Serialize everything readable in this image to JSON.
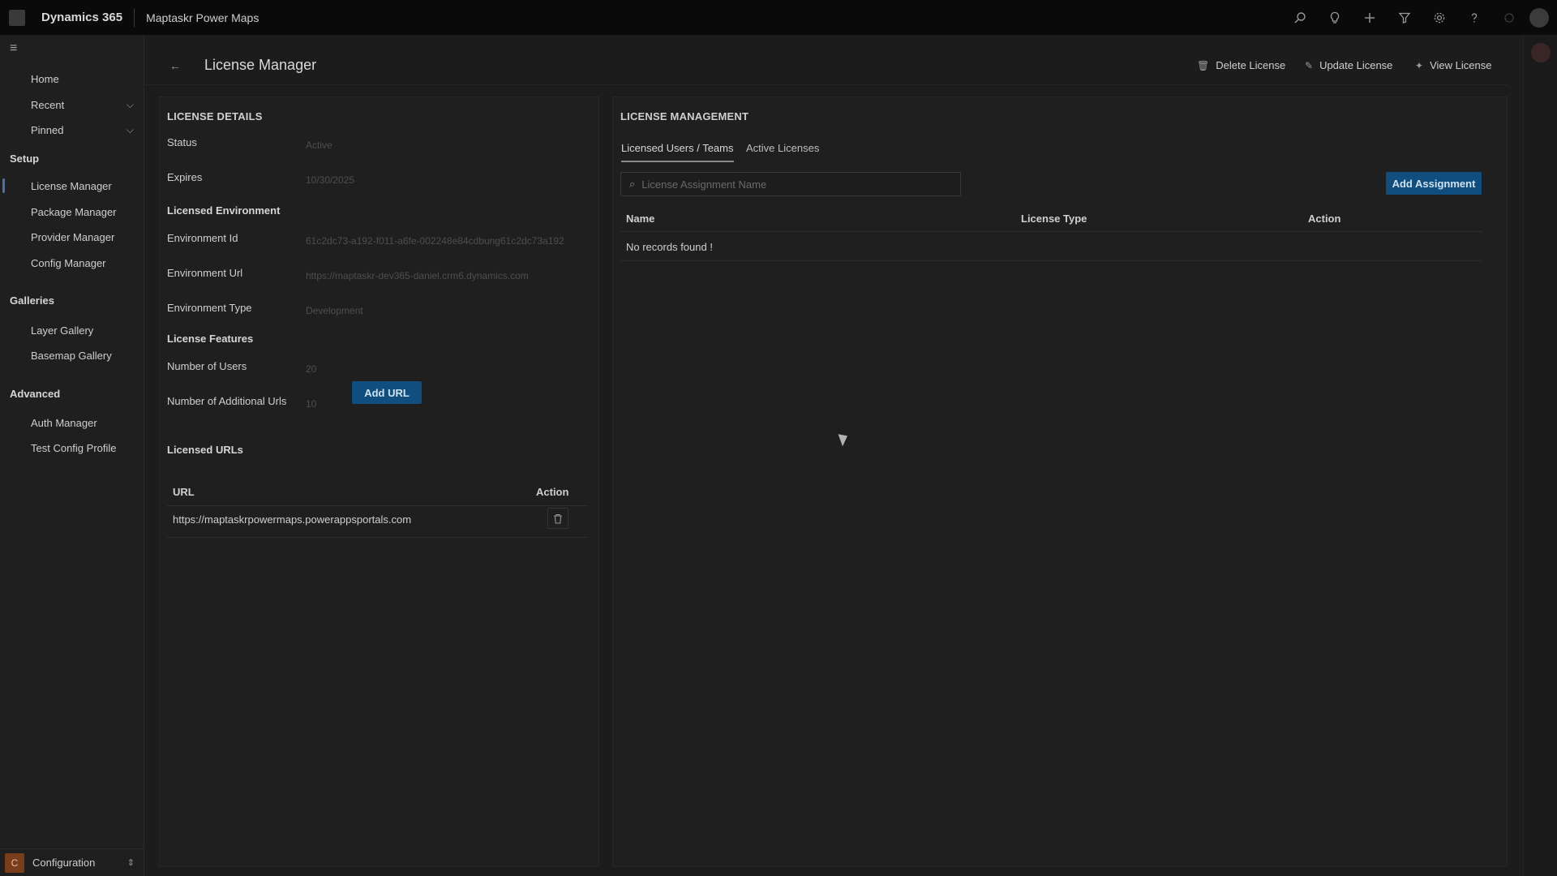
{
  "topbar": {
    "brand": "Dynamics 365",
    "app_name": "Maptaskr Power Maps",
    "icons": [
      "search-icon",
      "lightbulb-icon",
      "plus-icon",
      "filter-icon",
      "gear-icon",
      "help-icon",
      "chat-icon"
    ]
  },
  "sidebar": {
    "items_top": [
      {
        "label": "Home"
      },
      {
        "label": "Recent"
      },
      {
        "label": "Pinned"
      }
    ],
    "sections": [
      {
        "title": "Setup",
        "items": [
          "License Manager",
          "Package Manager",
          "Provider Manager",
          "Config Manager"
        ]
      },
      {
        "title": "Galleries",
        "items": [
          "Layer Gallery",
          "Basemap Gallery"
        ]
      },
      {
        "title": "Advanced",
        "items": [
          "Auth Manager",
          "Test Config Profile"
        ]
      }
    ],
    "active_item": "License Manager",
    "area": {
      "badge": "C",
      "label": "Configuration"
    }
  },
  "page": {
    "title": "License Manager",
    "commands": {
      "delete": "Delete License",
      "update": "Update License",
      "view": "View License"
    }
  },
  "details": {
    "heading": "LICENSE DETAILS",
    "status_label": "Status",
    "status_value": "Active",
    "expires_label": "Expires",
    "expires_value": "10/30/2025",
    "env_heading": "Licensed Environment",
    "env_id_label": "Environment Id",
    "env_id_value": "61c2dc73-a192-f011-a6fe-002248e84cdbung61c2dc73a192",
    "env_url_label": "Environment Url",
    "env_url_value": "https://maptaskr-dev365-daniel.crm6.dynamics.com",
    "env_type_label": "Environment Type",
    "env_type_value": "Development",
    "features_heading": "License Features",
    "users_label": "Number of Users",
    "users_value": "20",
    "add_urls_label": "Number of Additional Urls",
    "add_urls_value": "10",
    "urls_heading": "Licensed URLs",
    "add_url_button": "Add URL",
    "urls_table": {
      "col_url": "URL",
      "col_action": "Action",
      "rows": [
        {
          "url": "https://maptaskrpowermaps.powerappsportals.com"
        }
      ]
    }
  },
  "management": {
    "heading": "LICENSE MANAGEMENT",
    "tabs": [
      {
        "label": "Licensed Users / Teams",
        "active": true
      },
      {
        "label": "Active Licenses",
        "active": false
      }
    ],
    "search_placeholder": "License Assignment Name",
    "add_assignment_button": "Add Assignment",
    "table": {
      "col_name": "Name",
      "col_type": "License Type",
      "col_action": "Action",
      "empty_text": "No records found !"
    }
  },
  "colors": {
    "primary_button": "#0f4e7f",
    "active_indicator": "#4d6fb0",
    "area_badge": "#7a3e1c"
  }
}
